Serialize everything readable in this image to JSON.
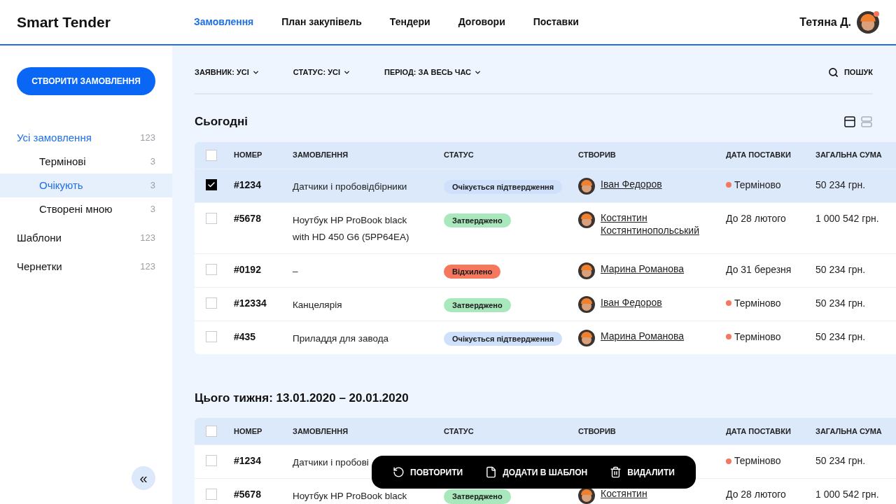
{
  "header": {
    "logo": "Smart Tender",
    "nav": [
      {
        "label": "Замовлення",
        "selected": true
      },
      {
        "label": "План закупівель",
        "selected": false
      },
      {
        "label": "Тендери",
        "selected": false
      },
      {
        "label": "Договори",
        "selected": false
      },
      {
        "label": "Поставки",
        "selected": false
      }
    ],
    "user": {
      "name": "Тетяна Д.",
      "notification": true
    }
  },
  "sidebar": {
    "create_button": "СТВОРИТИ ЗАМОВЛЕННЯ",
    "items": [
      {
        "label": "Усі замовлення",
        "count": "123",
        "selected": false,
        "active": true,
        "children": [
          {
            "label": "Термінові",
            "count": "3",
            "selected": false,
            "active": false
          },
          {
            "label": "Очікують",
            "count": "3",
            "selected": true,
            "active": false
          },
          {
            "label": "Створені мною",
            "count": "3",
            "selected": false,
            "active": false
          }
        ]
      },
      {
        "label": "Шаблони",
        "count": "123",
        "selected": false,
        "active": false
      },
      {
        "label": "Чернетки",
        "count": "123",
        "selected": false,
        "active": false
      }
    ],
    "collapse_button": "«"
  },
  "filters": [
    {
      "label": "ЗАЯВНИК: УСІ"
    },
    {
      "label": "СТАТУС: УСІ"
    },
    {
      "label": "ПЕРІОД: ЗА ВЕСЬ ЧАС"
    }
  ],
  "search": {
    "label": "ПОШУК"
  },
  "view_toggle": [
    {
      "kind": "card",
      "selected": true
    },
    {
      "kind": "list",
      "selected": false
    }
  ],
  "sections": [
    {
      "title": "Сьогодні",
      "columns": [
        "НОМЕР",
        "ЗАМОВЛЕННЯ",
        "СТАТУС",
        "СТВОРИВ",
        "ДАТА ПОСТАВКИ",
        "ЗАГАЛЬНА СУМА"
      ],
      "header_checked": false,
      "rows": [
        {
          "checked": true,
          "number": "#1234",
          "name": "Датчики і пробовідбірники",
          "status": {
            "label": "Очікується підтвердження",
            "kind": "pending"
          },
          "creator": "Іван Федоров",
          "urgent": true,
          "date": "Терміново",
          "sum": "50 234 грн."
        },
        {
          "checked": false,
          "number": "#5678",
          "name": "Ноутбук HP ProBook black with HD 450 G6 (5PP64EA)",
          "status": {
            "label": "Затверджено",
            "kind": "approved"
          },
          "creator": "Костянтин Костянтинопольський",
          "urgent": false,
          "date": "До 28 лютого",
          "sum": "1 000 542 грн."
        },
        {
          "checked": false,
          "number": "#0192",
          "name": "–",
          "status": {
            "label": "Відхилено",
            "kind": "rejected"
          },
          "creator": "Марина Романова",
          "urgent": false,
          "date": "До 31 березня",
          "sum": "50 234 грн."
        },
        {
          "checked": false,
          "number": "#12334",
          "name": "Канцелярія",
          "status": {
            "label": "Затверджено",
            "kind": "approved"
          },
          "creator": "Іван Федоров",
          "urgent": true,
          "date": "Терміново",
          "sum": "50 234 грн."
        },
        {
          "checked": false,
          "number": "#435",
          "name": "Приладдя для завода",
          "status": {
            "label": "Очікується підтвердження",
            "kind": "pending"
          },
          "creator": "Марина Романова",
          "urgent": true,
          "date": "Терміново",
          "sum": "50 234 грн."
        }
      ]
    },
    {
      "title": "Цього тижня: 13.01.2020 – 20.01.2020",
      "columns": [
        "НОМЕР",
        "ЗАМОВЛЕННЯ",
        "СТАТУС",
        "СТВОРИВ",
        "ДАТА ПОСТАВКИ",
        "ЗАГАЛЬНА СУМА"
      ],
      "header_checked": false,
      "rows": [
        {
          "checked": false,
          "number": "#1234",
          "name": "Датчики і пробові",
          "urgent": true,
          "date": "Терміново",
          "sum": "50 234 грн."
        },
        {
          "checked": false,
          "number": "#5678",
          "name": "Ноутбук HP ProBook black",
          "status": {
            "label": "Затверджено",
            "kind": "approved"
          },
          "creator": "Костянтин",
          "urgent": false,
          "date": "До 28 лютого",
          "sum": "1 000 542 грн."
        }
      ]
    }
  ],
  "action_bar": [
    {
      "label": "ПОВТОРИТИ",
      "kind": "repeat"
    },
    {
      "label": "ДОДАТИ В ШАБЛОН",
      "kind": "template"
    },
    {
      "label": "ВИДАЛИТИ",
      "kind": "delete"
    }
  ]
}
